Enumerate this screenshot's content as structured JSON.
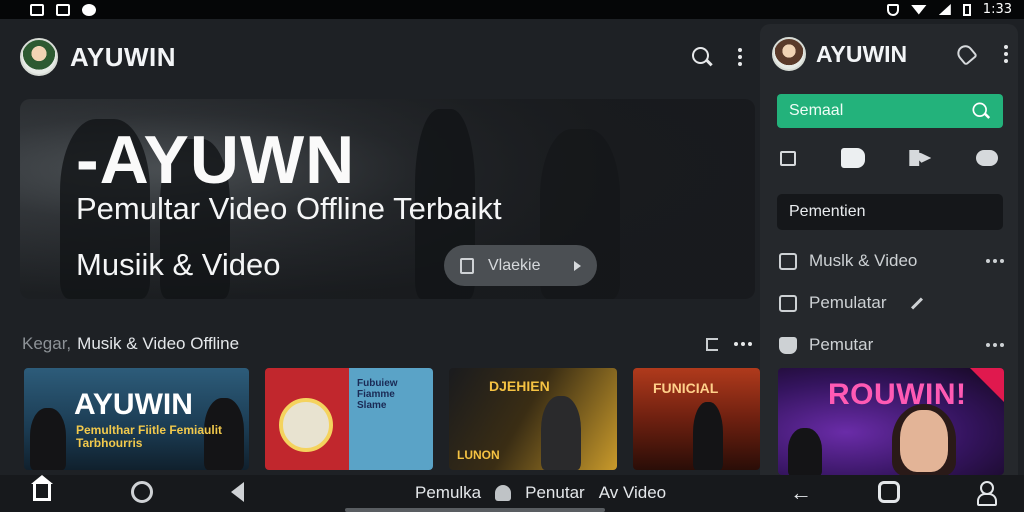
{
  "status_bar": {
    "time": "1:33"
  },
  "app": {
    "title": "AYUWIN"
  },
  "hero": {
    "title": "-AYUWN",
    "subtitle": "Pemultar Video Offline Terbaikt",
    "subtitle2": "Musiik & Video",
    "button_label": "Vlaekie"
  },
  "section": {
    "muted": "Kegar,",
    "title": "Musik & Video Offline"
  },
  "thumbnails": [
    {
      "title": "AYUWIN",
      "subtitle": "Pemulthar Fiitle Femiaulit Tarbhourris"
    },
    {
      "title": "Fubuiew Fiamme Slame"
    },
    {
      "title": "DJEHIEN",
      "subtitle": "LUNON"
    },
    {
      "title": "FUNICIAL"
    }
  ],
  "bottom_nav": {
    "tab1": "Pemulka",
    "tab2": "Penutar",
    "tab3": "Av Video"
  },
  "panel": {
    "title": "AYUWIN",
    "search_label": "Semaal",
    "section_label": "Pementien",
    "items": [
      {
        "label": "Muslk & Video"
      },
      {
        "label": "Pemulatar"
      },
      {
        "label": "Pemutar"
      }
    ],
    "card_title": "ROUWIN!"
  },
  "colors": {
    "accent": "#23b27b",
    "background": "#1e2125",
    "panel": "#25282c"
  },
  "icons": [
    "search-icon",
    "more-vertical-icon",
    "mic-icon",
    "home-icon",
    "back-icon",
    "user-icon",
    "pencil-icon",
    "more-horizontal-icon"
  ]
}
